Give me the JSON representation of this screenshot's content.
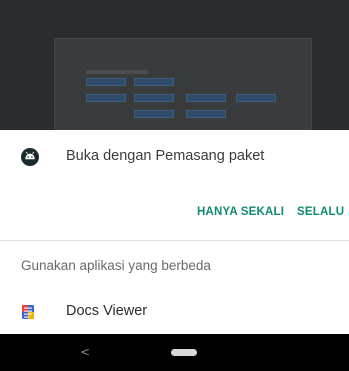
{
  "background": {
    "description_visible": false
  },
  "sheet": {
    "open_with_label": "Buka dengan Pemasang paket",
    "open_with_icon": "android-icon",
    "just_once_label": "HANYA SEKALI",
    "always_label": "SELALU",
    "accent_color": "#108b73",
    "other_apps_label": "Gunakan aplikasi yang berbeda",
    "apps": [
      {
        "label": "Docs Viewer",
        "icon": "docs-viewer-icon"
      }
    ]
  },
  "navbar": {
    "back_glyph": "<",
    "back_icon": "back-chevron-icon",
    "home_icon": "home-pill-icon"
  }
}
